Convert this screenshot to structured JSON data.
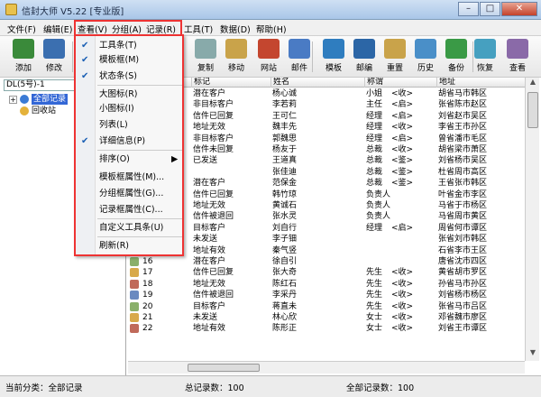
{
  "window": {
    "title": "信封大师 V5.22 [专业版]",
    "min": "–",
    "max": "□",
    "close": "✕"
  },
  "menubar": [
    "文件(F)",
    "编辑(E)",
    "查看(V)",
    "分组(A)",
    "记录(R)",
    "工具(T)",
    "数据(D)",
    "帮助(H)"
  ],
  "toolbar": {
    "left": [
      {
        "label": "添加",
        "icon": "add-icon",
        "color": "#3a8a3a"
      },
      {
        "label": "修改",
        "icon": "edit-icon",
        "color": "#3b6fb0"
      }
    ],
    "right": [
      {
        "label": "复制",
        "icon": "copy-icon",
        "color": "#8aa"
      },
      {
        "label": "移动",
        "icon": "move-icon",
        "color": "#c9a34a"
      },
      {
        "label": "网站",
        "icon": "home-icon",
        "color": "#c4462f"
      },
      {
        "label": "邮件",
        "icon": "mail-icon",
        "color": "#4a7bc4"
      },
      {
        "label": "模板",
        "icon": "template-icon",
        "color": "#2f7dbf"
      },
      {
        "label": "邮编",
        "icon": "zipcode-icon",
        "color": "#2c66a6"
      },
      {
        "label": "重置",
        "icon": "reset-icon",
        "color": "#c9a34a"
      },
      {
        "label": "历史",
        "icon": "history-icon",
        "color": "#4a8fc8"
      },
      {
        "label": "备份",
        "icon": "backup-icon",
        "color": "#3a9a46"
      },
      {
        "label": "恢复",
        "icon": "restore-icon",
        "color": "#46a0c0"
      },
      {
        "label": "查看",
        "icon": "view-icon",
        "color": "#8a6aa8"
      }
    ]
  },
  "view_menu": {
    "items": [
      {
        "label": "工具条(T)",
        "checked": true
      },
      {
        "label": "模板框(M)",
        "checked": true
      },
      {
        "label": "状态条(S)",
        "checked": true
      },
      {
        "label": "大图标(R)",
        "checked": false
      },
      {
        "label": "小图标(I)",
        "checked": false
      },
      {
        "label": "列表(L)",
        "checked": false
      },
      {
        "label": "详细信息(P)",
        "checked": true
      },
      {
        "label": "排序(O)",
        "checked": false,
        "submenu": "▶"
      },
      {
        "label": "模板框属性(M)...",
        "checked": false
      },
      {
        "label": "分组框属性(G)...",
        "checked": false
      },
      {
        "label": "记录框属性(C)...",
        "checked": false
      },
      {
        "label": "自定义工具条(U)",
        "checked": false
      },
      {
        "label": "刷新(R)",
        "checked": false
      }
    ]
  },
  "tree": {
    "path": "DL(5号)-1",
    "root": "全部记录",
    "recycle": "回收站",
    "expander": "+"
  },
  "grid": {
    "columns": [
      "标记",
      "姓名",
      "称谓",
      "地址"
    ],
    "rows": [
      {
        "n": "",
        "tag": "潜在客户",
        "name": "杨心诚",
        "title": "小姐",
        "sal": "<收>",
        "addr": "胡省马市韩区"
      },
      {
        "n": "",
        "tag": "非目标客户",
        "name": "李若莉",
        "title": "主任",
        "sal": "<启>",
        "addr": "张省陈市赵区"
      },
      {
        "n": "",
        "tag": "信件已回复",
        "name": "王可仁",
        "title": "经理",
        "sal": "<启>",
        "addr": "刘省赵市吴区"
      },
      {
        "n": "",
        "tag": "地址无效",
        "name": "魏丰先",
        "title": "经理",
        "sal": "<收>",
        "addr": "李省王市孙区"
      },
      {
        "n": "",
        "tag": "非目标客户",
        "name": "郭魏思",
        "title": "经理",
        "sal": "<启>",
        "addr": "曾省潘市毛区"
      },
      {
        "n": "",
        "tag": "信件未回复",
        "name": "杨友于",
        "title": "总裁",
        "sal": "<收>",
        "addr": "胡省梁市萧区"
      },
      {
        "n": "",
        "tag": "已发送",
        "name": "王道真",
        "title": "总裁",
        "sal": "<鉴>",
        "addr": "刘省杨市吴区"
      },
      {
        "n": "",
        "tag": "",
        "name": "张佳迪",
        "title": "总裁",
        "sal": "<鉴>",
        "addr": "杜省周市高区"
      },
      {
        "n": "",
        "tag": "潜在客户",
        "name": "范保金",
        "title": "总裁",
        "sal": "<鉴>",
        "addr": "王省张市韩区"
      },
      {
        "n": "",
        "tag": "信件已回复",
        "name": "韩竹琼",
        "title": "负责人",
        "sal": "",
        "addr": "叶省金市李区"
      },
      {
        "n": "",
        "tag": "地址无效",
        "name": "黄诚石",
        "title": "负责人",
        "sal": "",
        "addr": "马省于市杨区"
      },
      {
        "n": "",
        "tag": "信件被退回",
        "name": "张水灵",
        "title": "负责人",
        "sal": "",
        "addr": "马省周市黄区"
      },
      {
        "n": "",
        "tag": "目标客户",
        "name": "刘自行",
        "title": "经理",
        "sal": "<启>",
        "addr": "周省何市谭区"
      },
      {
        "n": "",
        "tag": "未发送",
        "name": "李子钿",
        "title": "",
        "sal": "",
        "addr": "张省刘市韩区"
      },
      {
        "n": "15",
        "tag": "地址有效",
        "name": "秦气竖",
        "title": "",
        "sal": "",
        "addr": "石省李市王区"
      },
      {
        "n": "16",
        "tag": "潜在客户",
        "name": "徐自引",
        "title": "",
        "sal": "",
        "addr": "唐省沈市四区"
      },
      {
        "n": "17",
        "tag": "信件已回复",
        "name": "张大奇",
        "title": "先生",
        "sal": "<收>",
        "addr": "黄省胡市罗区"
      },
      {
        "n": "18",
        "tag": "地址无效",
        "name": "陈红石",
        "title": "先生",
        "sal": "<收>",
        "addr": "孙省马市孙区"
      },
      {
        "n": "19",
        "tag": "信件被退回",
        "name": "李采丹",
        "title": "先生",
        "sal": "<收>",
        "addr": "刘省杨市杨区"
      },
      {
        "n": "20",
        "tag": "目标客户",
        "name": "蒋直未",
        "title": "先生",
        "sal": "<收>",
        "addr": "张省马市吕区"
      },
      {
        "n": "21",
        "tag": "未发送",
        "name": "林心欣",
        "title": "女士",
        "sal": "<收>",
        "addr": "邓省魏市廖区"
      },
      {
        "n": "22",
        "tag": "地址有效",
        "name": "陈形正",
        "title": "女士",
        "sal": "<收>",
        "addr": "刘省王市谭区"
      }
    ]
  },
  "status": {
    "category": "当前分类：全部记录",
    "total": "总记录数：100",
    "all": "全部记录数：100"
  },
  "colors": {
    "menu_border": "#e33",
    "selection": "#3367d6"
  }
}
